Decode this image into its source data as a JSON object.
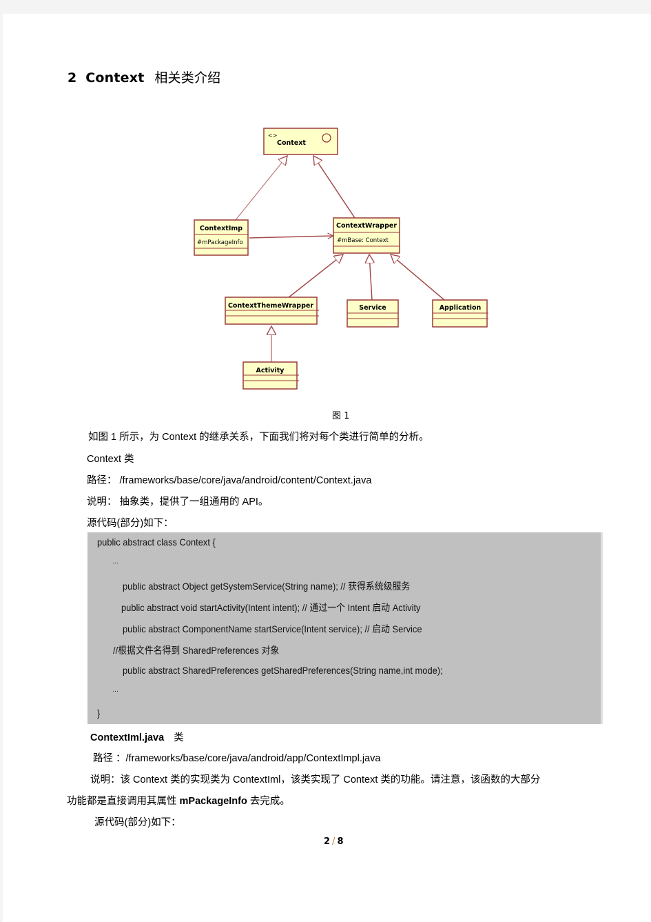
{
  "section": {
    "number": "2",
    "title_en": "Context",
    "title_cn": "相关类介绍"
  },
  "diagram": {
    "colors": {
      "box_fill": "#ffffc8",
      "box_border": "#9a3a3a",
      "line": "#a34a4a"
    },
    "classes": {
      "context": {
        "stereotype": "<>",
        "name": "Context"
      },
      "context_imp": {
        "name": "ContextImp",
        "attribute": "#mPackageInfo"
      },
      "context_wrapper": {
        "name": "ContextWrapper",
        "attribute": "#mBase:  Context"
      },
      "context_theme_wrapper": {
        "name": "ContextThemeWrapper"
      },
      "service": {
        "name": "Service"
      },
      "application": {
        "name": "Application"
      },
      "activity": {
        "name": "Activity"
      }
    },
    "caption": "图 1"
  },
  "body": {
    "intro": "如图 1 所示，为 Context 的继承关系，下面我们将对每个类进行简单的分析。",
    "context_class": {
      "title": "Context 类",
      "path": "路径：  /frameworks/base/core/java/android/content/Context.java",
      "desc": "说明：   抽象类，提供了一组通用的 API。",
      "source_label": "源代码(部分)如下："
    },
    "code": {
      "lines": [
        "public  abstract  class  Context  {",
        "…",
        "public  abstract  Object  getSystemService(String  name);    // 获得系统级服务",
        "public  abstract  void  startActivity(Intent  intent);         // 通过一个 Intent 启动 Activity",
        "public  abstract  ComponentName  startService(Intent  service);    // 启动 Service",
        "//根据文件名得到 SharedPreferences 对象",
        "public  abstract  SharedPreferences  getSharedPreferences(String  name,int  mode);",
        "…",
        "}"
      ],
      "background": "#c0c0c0"
    },
    "contextimpl_class": {
      "title": "ContextIml.java",
      "title_suffix": "类",
      "path": "路径  ：/frameworks/base/core/java/android/app/ContextImpl.java",
      "desc_line1": "说明：该 Context 类的实现类为 ContextIml，该类实现了 Context 类的功能。请注意，该函数的大部分",
      "desc_line2_prefix": "功能都是直接调用其属性 ",
      "desc_line2_bold": "mPackageInfo",
      "desc_line2_suffix": "  去完成。",
      "source_label": "源代码(部分)如下："
    }
  },
  "footer": {
    "current_page": "2",
    "separator": "/",
    "total_pages": "8"
  }
}
